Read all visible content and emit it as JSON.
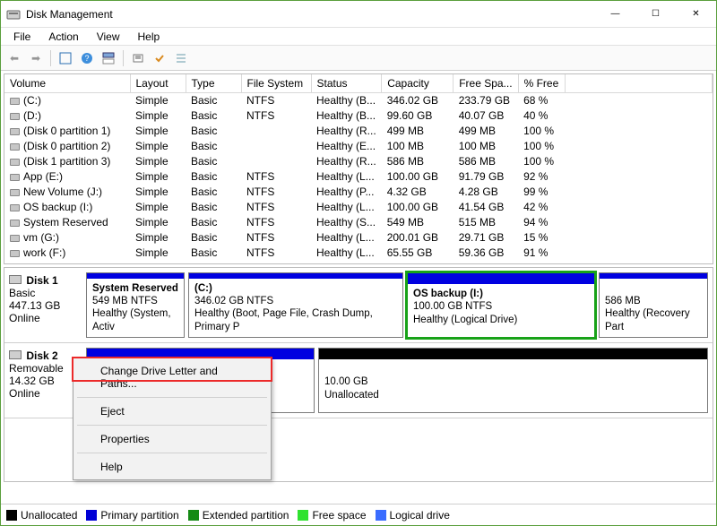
{
  "window": {
    "title": "Disk Management",
    "controls": {
      "min": "—",
      "max": "☐",
      "close": "✕"
    }
  },
  "menu": {
    "file": "File",
    "action": "Action",
    "view": "View",
    "help": "Help"
  },
  "table": {
    "headers": {
      "volume": "Volume",
      "layout": "Layout",
      "type": "Type",
      "fs": "File System",
      "status": "Status",
      "capacity": "Capacity",
      "free": "Free Spa...",
      "pfree": "% Free"
    },
    "rows": [
      {
        "vol": "(C:)",
        "layout": "Simple",
        "type": "Basic",
        "fs": "NTFS",
        "status": "Healthy (B...",
        "cap": "346.02 GB",
        "free": "233.79 GB",
        "pfree": "68 %"
      },
      {
        "vol": "(D:)",
        "layout": "Simple",
        "type": "Basic",
        "fs": "NTFS",
        "status": "Healthy (B...",
        "cap": "99.60 GB",
        "free": "40.07 GB",
        "pfree": "40 %"
      },
      {
        "vol": "(Disk 0 partition 1)",
        "layout": "Simple",
        "type": "Basic",
        "fs": "",
        "status": "Healthy (R...",
        "cap": "499 MB",
        "free": "499 MB",
        "pfree": "100 %"
      },
      {
        "vol": "(Disk 0 partition 2)",
        "layout": "Simple",
        "type": "Basic",
        "fs": "",
        "status": "Healthy (E...",
        "cap": "100 MB",
        "free": "100 MB",
        "pfree": "100 %"
      },
      {
        "vol": "(Disk 1 partition 3)",
        "layout": "Simple",
        "type": "Basic",
        "fs": "",
        "status": "Healthy (R...",
        "cap": "586 MB",
        "free": "586 MB",
        "pfree": "100 %"
      },
      {
        "vol": "App (E:)",
        "layout": "Simple",
        "type": "Basic",
        "fs": "NTFS",
        "status": "Healthy (L...",
        "cap": "100.00 GB",
        "free": "91.79 GB",
        "pfree": "92 %"
      },
      {
        "vol": "New Volume (J:)",
        "layout": "Simple",
        "type": "Basic",
        "fs": "NTFS",
        "status": "Healthy (P...",
        "cap": "4.32 GB",
        "free": "4.28 GB",
        "pfree": "99 %"
      },
      {
        "vol": "OS backup (I:)",
        "layout": "Simple",
        "type": "Basic",
        "fs": "NTFS",
        "status": "Healthy (L...",
        "cap": "100.00 GB",
        "free": "41.54 GB",
        "pfree": "42 %"
      },
      {
        "vol": "System Reserved",
        "layout": "Simple",
        "type": "Basic",
        "fs": "NTFS",
        "status": "Healthy (S...",
        "cap": "549 MB",
        "free": "515 MB",
        "pfree": "94 %"
      },
      {
        "vol": "vm (G:)",
        "layout": "Simple",
        "type": "Basic",
        "fs": "NTFS",
        "status": "Healthy (L...",
        "cap": "200.01 GB",
        "free": "29.71 GB",
        "pfree": "15 %"
      },
      {
        "vol": "work (F:)",
        "layout": "Simple",
        "type": "Basic",
        "fs": "NTFS",
        "status": "Healthy (L...",
        "cap": "65.55 GB",
        "free": "59.36 GB",
        "pfree": "91 %"
      }
    ]
  },
  "disks": {
    "d1": {
      "name": "Disk 1",
      "type": "Basic",
      "size": "447.13 GB",
      "status": "Online",
      "parts": [
        {
          "title": "System Reserved",
          "line2": "549 MB NTFS",
          "line3": "Healthy (System, Activ"
        },
        {
          "title": "(C:)",
          "line2": "346.02 GB NTFS",
          "line3": "Healthy (Boot, Page File, Crash Dump, Primary P"
        },
        {
          "title": "OS backup  (I:)",
          "line2": "100.00 GB NTFS",
          "line3": "Healthy (Logical Drive)"
        },
        {
          "title": "",
          "line2": "586 MB",
          "line3": "Healthy (Recovery Part"
        }
      ]
    },
    "d2": {
      "name": "Disk 2",
      "type": "Removable",
      "size": "14.32 GB",
      "status": "Online",
      "parts": [
        {
          "title": "",
          "line2": "",
          "line3": ""
        },
        {
          "title": "",
          "line2": "10.00 GB",
          "line3": "Unallocated"
        }
      ]
    }
  },
  "context_menu": {
    "change": "Change Drive Letter and Paths...",
    "eject": "Eject",
    "properties": "Properties",
    "help": "Help"
  },
  "legend": {
    "unalloc": "Unallocated",
    "primary": "Primary partition",
    "extended": "Extended partition",
    "free": "Free space",
    "logical": "Logical drive"
  }
}
